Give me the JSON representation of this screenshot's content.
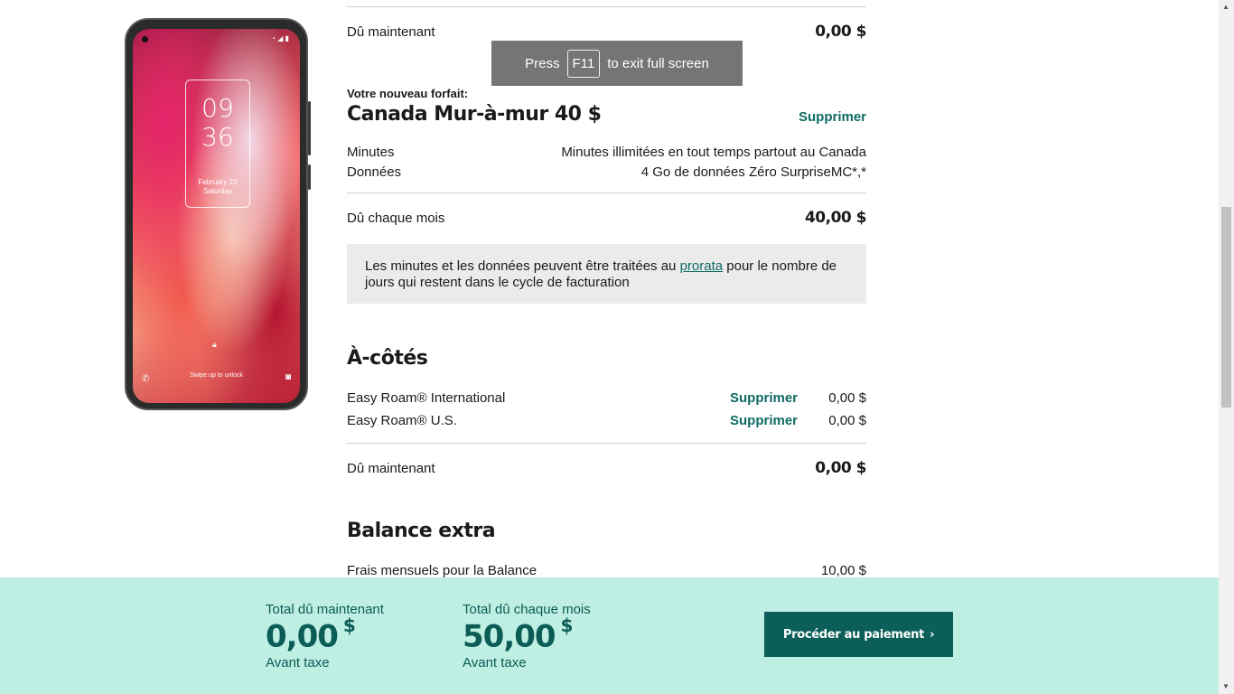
{
  "phone": {
    "clock_hour": "09",
    "clock_minute": "36",
    "date": "February 22",
    "day": "Saturday",
    "swipe_text": "Swipe up to unlock"
  },
  "top_due": {
    "label": "Dû maintenant",
    "value": "0,00 $"
  },
  "fullscreen_notice": {
    "press": "Press",
    "key": "F11",
    "suffix": "to exit full screen"
  },
  "plan": {
    "kicker": "Votre nouveau forfait:",
    "name": "Canada Mur-à-mur 40 $",
    "remove": "Supprimer",
    "rows": [
      {
        "label": "Minutes",
        "value": "Minutes illimitées en tout temps partout au Canada"
      },
      {
        "label": "Données",
        "value": "4 Go de données Zéro SurpriseMC*,*"
      }
    ],
    "monthly_label": "Dû chaque mois",
    "monthly_value": "40,00 $",
    "note_before": "Les minutes et les données peuvent être traitées au",
    "note_link": "prorata",
    "note_after": "pour le nombre de jours qui restent dans le cycle de facturation"
  },
  "addons": {
    "title": "À-côtés",
    "items": [
      {
        "name": "Easy Roam® International",
        "remove": "Supprimer",
        "price": "0,00 $"
      },
      {
        "name": "Easy Roam® U.S.",
        "remove": "Supprimer",
        "price": "0,00 $"
      }
    ],
    "due_label": "Dû maintenant",
    "due_value": "0,00 $"
  },
  "balance": {
    "title": "Balance extra",
    "row_label": "Frais mensuels pour la Balance",
    "row_value": "10,00 $"
  },
  "footer": {
    "now_label": "Total dû maintenant",
    "now_amount": "0,00",
    "now_currency": "$",
    "now_note": "Avant taxe",
    "monthly_label": "Total dû chaque mois",
    "monthly_amount": "50,00",
    "monthly_currency": "$",
    "monthly_note": "Avant taxe",
    "button_label": "Procéder au paiement",
    "button_icon": "chevron-right-icon"
  },
  "colors": {
    "accent": "#0f6b63",
    "footer_bg": "#bfeee3",
    "button_bg": "#0b5f58",
    "note_bg": "#ebebeb"
  }
}
